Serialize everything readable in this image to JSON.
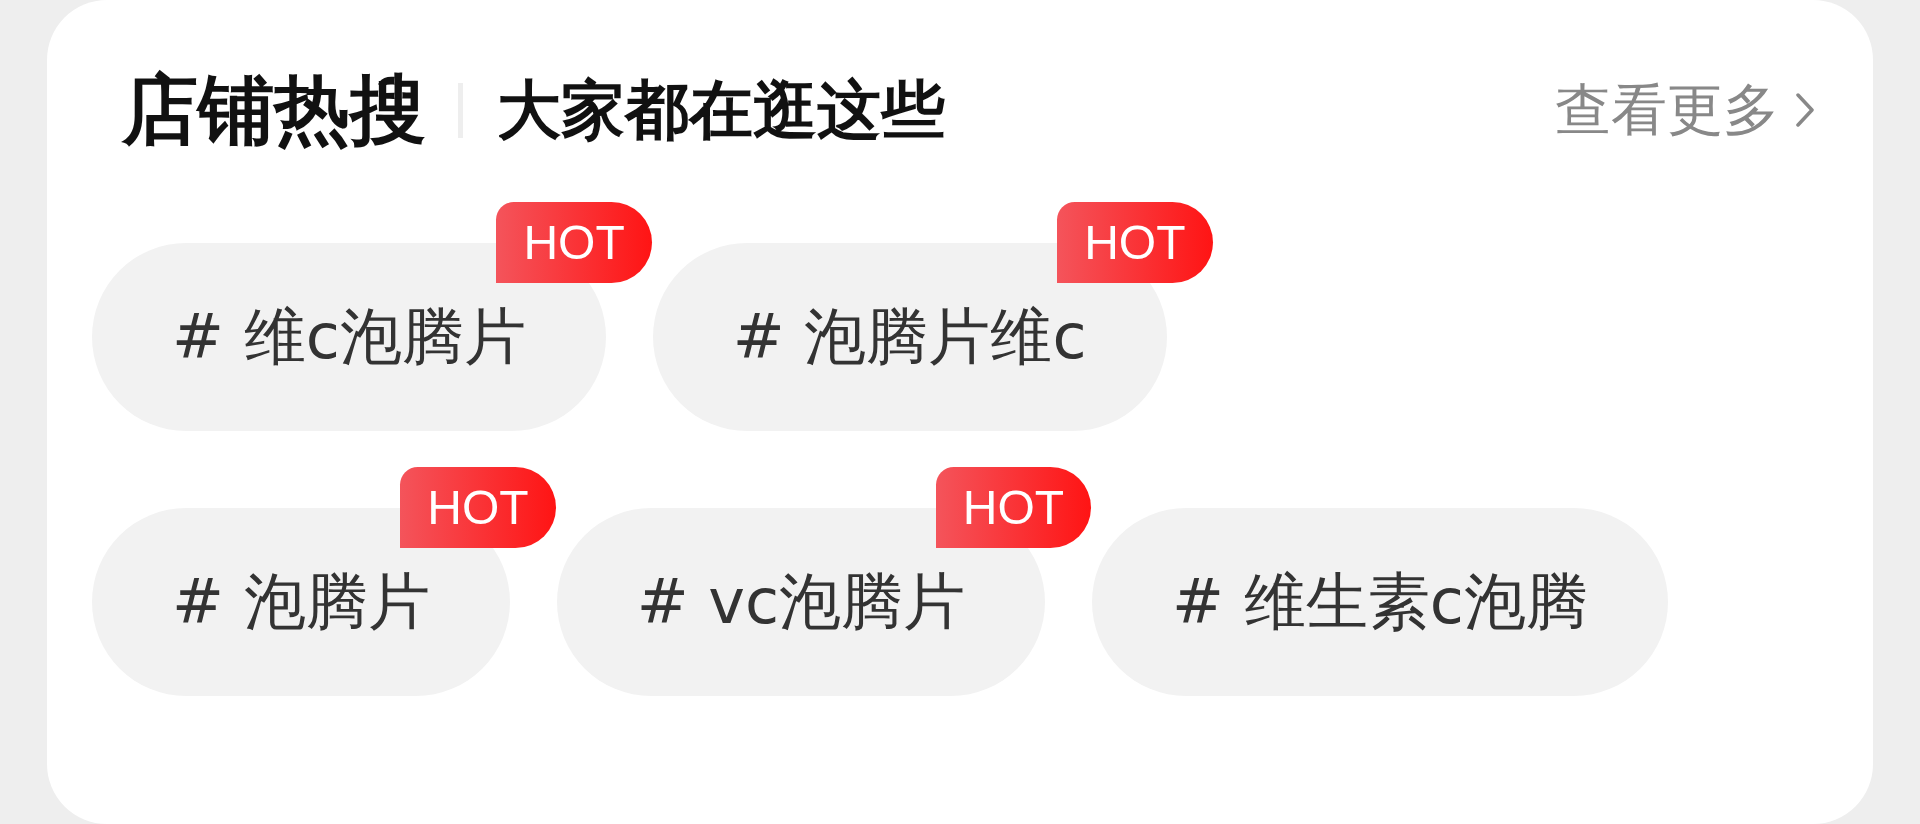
{
  "header": {
    "title": "店铺热搜",
    "subtitle": "大家都在逛这些",
    "more_link": "查看更多"
  },
  "rows": [
    {
      "tags": [
        {
          "label": "# 维c泡腾片",
          "badge": "HOT"
        },
        {
          "label": "# 泡腾片维c",
          "badge": "HOT"
        }
      ]
    },
    {
      "tags": [
        {
          "label": "# 泡腾片",
          "badge": "HOT"
        },
        {
          "label": "# vc泡腾片",
          "badge": "HOT"
        },
        {
          "label": "# 维生素c泡腾"
        }
      ]
    }
  ]
}
